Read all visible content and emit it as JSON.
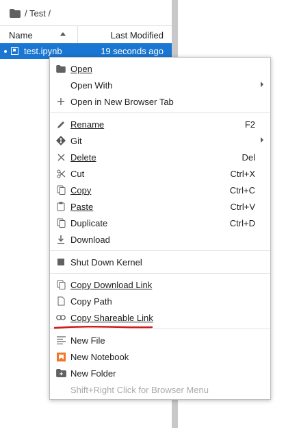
{
  "breadcrumb": {
    "path": "/ Test /"
  },
  "columns": {
    "name": "Name",
    "modified": "Last Modified"
  },
  "file": {
    "name": "test.ipynb",
    "modified": "19 seconds ago"
  },
  "menu": {
    "open": "Open",
    "open_with": "Open With",
    "open_new_tab": "Open in New Browser Tab",
    "rename": "Rename",
    "rename_sc": "F2",
    "git": "Git",
    "delete": "Delete",
    "delete_sc": "Del",
    "cut": "Cut",
    "cut_sc": "Ctrl+X",
    "copy": "Copy",
    "copy_sc": "Ctrl+C",
    "paste": "Paste",
    "paste_sc": "Ctrl+V",
    "duplicate": "Duplicate",
    "duplicate_sc": "Ctrl+D",
    "download": "Download",
    "shutdown": "Shut Down Kernel",
    "copy_download_link": "Copy Download Link",
    "copy_path": "Copy Path",
    "copy_shareable": "Copy Shareable Link",
    "new_file": "New File",
    "new_notebook": "New Notebook",
    "new_folder": "New Folder",
    "browser_menu_hint": "Shift+Right Click for Browser Menu"
  },
  "colors": {
    "selection": "#1976d2",
    "notebook_icon": "#f37626",
    "underline_annotation": "#d01c1c"
  }
}
